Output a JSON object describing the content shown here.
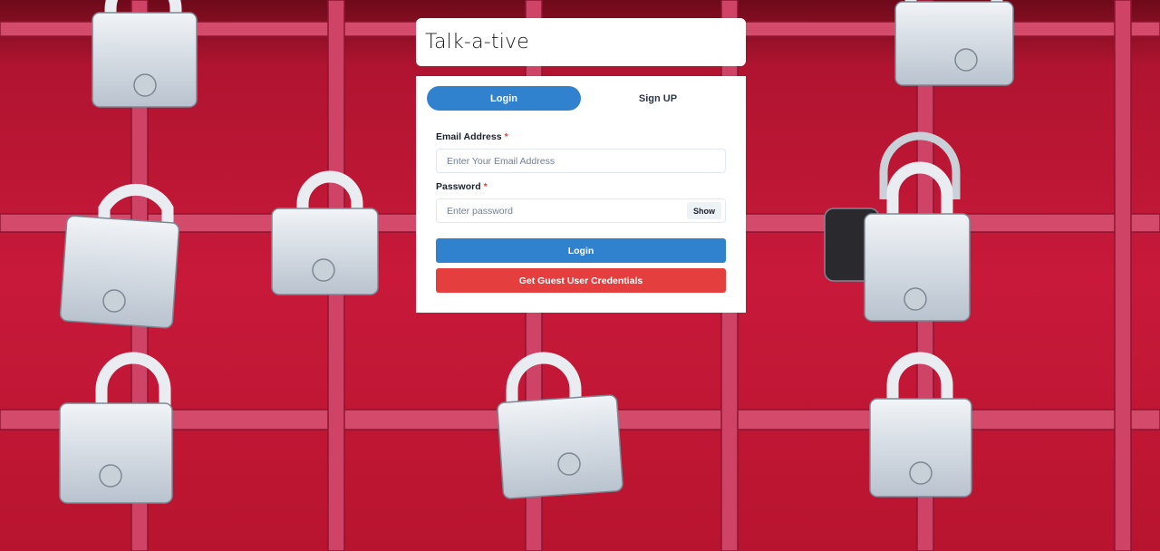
{
  "app": {
    "title": "Talk-a-tive"
  },
  "tabs": [
    {
      "label": "Login",
      "active": true
    },
    {
      "label": "Sign UP",
      "active": false
    }
  ],
  "form": {
    "email": {
      "label": "Email Address",
      "required_marker": "*",
      "placeholder": "Enter Your Email Address",
      "value": ""
    },
    "password": {
      "label": "Password",
      "required_marker": "*",
      "placeholder": "Enter password",
      "value": "",
      "toggle_label": "Show"
    },
    "login_button": "Login",
    "guest_button": "Get Guest User Credentials"
  },
  "background": {
    "description_icon": "padlocks-on-red-grate-photo",
    "fence_color": "#c41e3a",
    "grid_color": "#d94a6a",
    "lock_color": "#d7dde4"
  },
  "colors": {
    "accent": "#3182ce",
    "danger": "#e53e3e"
  }
}
